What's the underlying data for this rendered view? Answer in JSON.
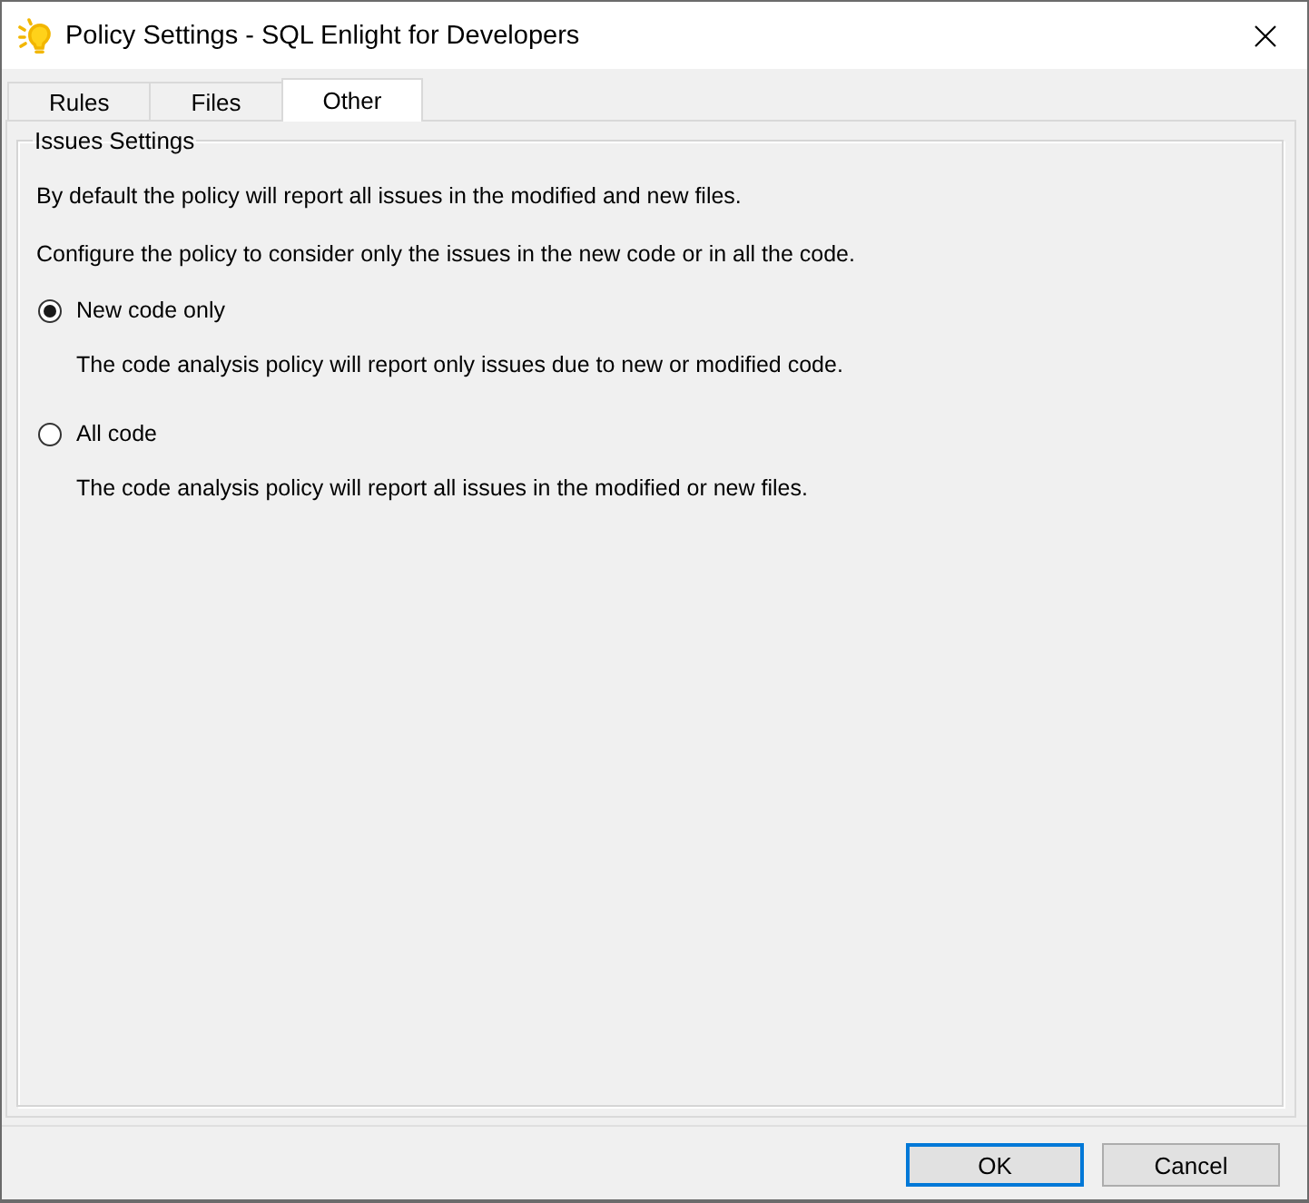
{
  "window": {
    "title": "Policy Settings - SQL Enlight for Developers"
  },
  "tabs": [
    {
      "label": "Rules",
      "selected": false
    },
    {
      "label": "Files",
      "selected": false
    },
    {
      "label": "Other",
      "selected": true
    }
  ],
  "group": {
    "title": "Issues Settings",
    "paragraphs": [
      "By default the policy will report all issues in the modified and new files.",
      "Configure the policy to consider only the issues in the new code or in all the code."
    ],
    "options": [
      {
        "label": "New code only",
        "selected": true,
        "description": "The code analysis policy will report only issues due to new or modified code."
      },
      {
        "label": "All code",
        "selected": false,
        "description": "The code analysis policy will report all issues in the modified or new files."
      }
    ]
  },
  "buttons": [
    {
      "label": "OK",
      "default": true
    },
    {
      "label": "Cancel",
      "default": false
    }
  ]
}
